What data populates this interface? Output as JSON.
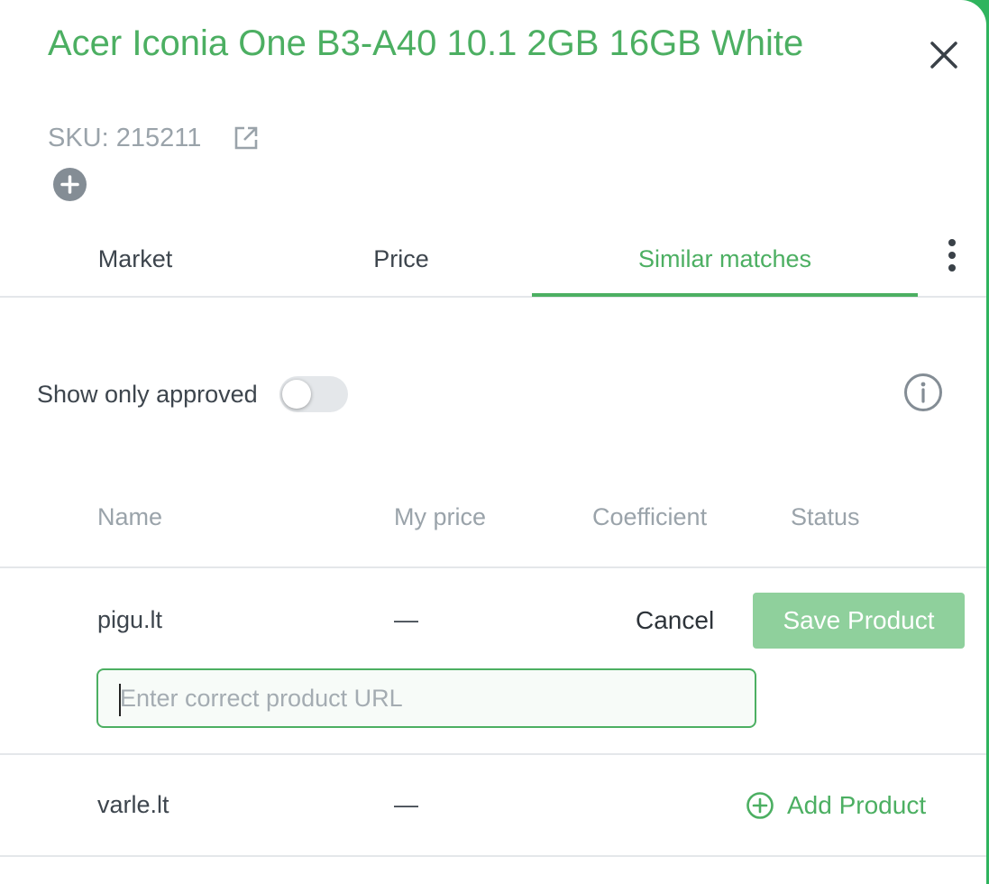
{
  "product": {
    "title": "Acer Iconia One B3-A40 10.1 2GB 16GB White",
    "sku_label": "SKU: 215211"
  },
  "tabs": [
    {
      "label": "Market",
      "active": false
    },
    {
      "label": "Price",
      "active": false
    },
    {
      "label": "Similar matches",
      "active": true
    }
  ],
  "filter": {
    "show_only_approved_label": "Show only approved",
    "show_only_approved_on": false
  },
  "table": {
    "headers": [
      "Name",
      "My price",
      "Coefficient",
      "Status"
    ],
    "rows": [
      {
        "name": "pigu.lt",
        "my_price": "—",
        "cancel_label": "Cancel",
        "save_label": "Save Product",
        "url_placeholder": "Enter correct product URL",
        "url_value": ""
      },
      {
        "name": "varle.lt",
        "my_price": "—",
        "add_label": "Add Product"
      }
    ]
  },
  "icons": {
    "close": "close-icon",
    "external_link": "external-link-icon",
    "add": "plus-circle-icon",
    "more": "more-vertical-icon",
    "info": "info-icon",
    "add_product": "plus-circle-outline-icon"
  },
  "colors": {
    "accent": "#4caf62",
    "save_disabled": "#8fd09c",
    "muted_text": "#9aa3aa",
    "frame": "#2fb45e"
  }
}
